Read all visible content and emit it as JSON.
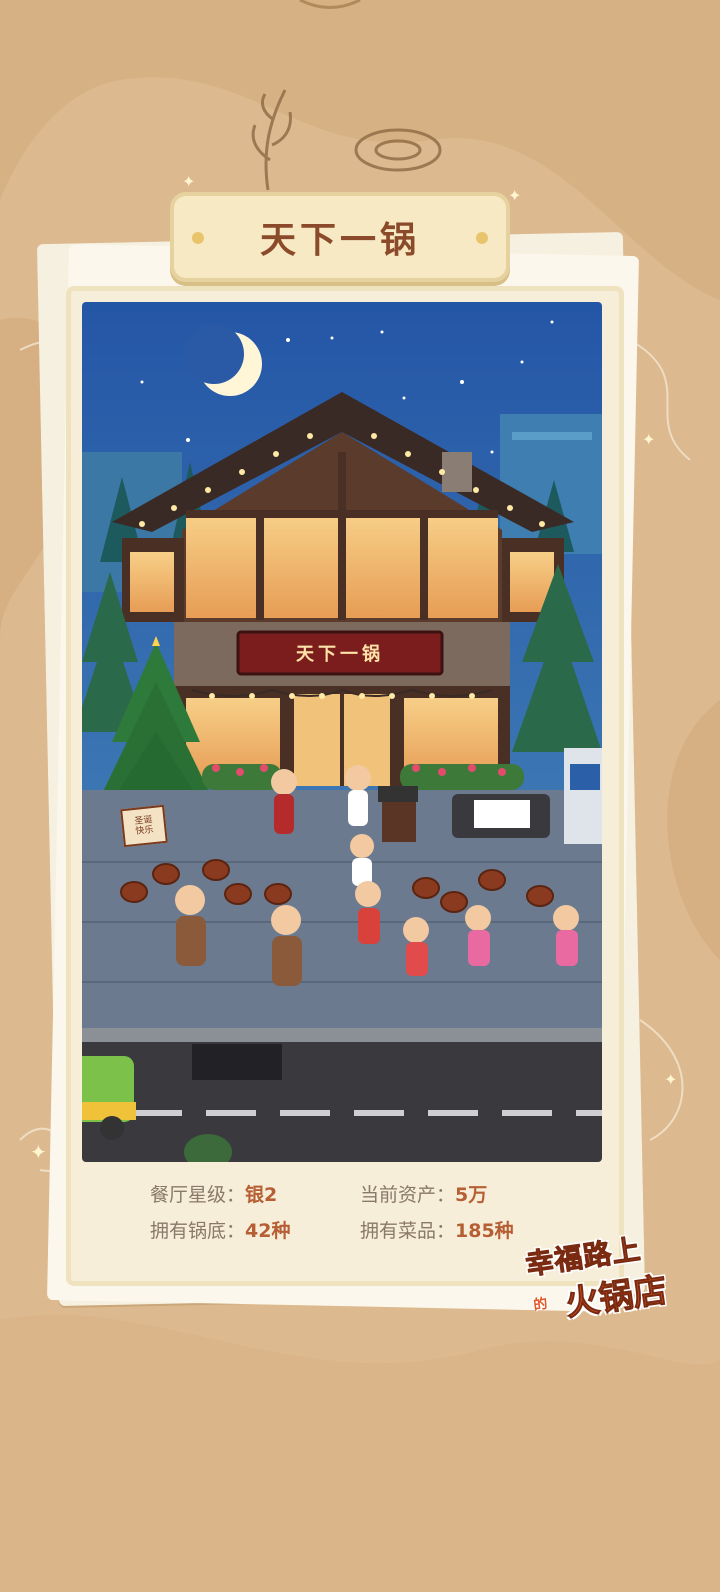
{
  "restaurant": {
    "name": "天下一锅",
    "sign_text": "天下一锅",
    "tree_sign": "圣诞快乐"
  },
  "stats": {
    "star_label": "餐厅星级：",
    "star_value": "银2",
    "assets_label": "当前资产：",
    "assets_value": "5万",
    "bases_label": "拥有锅底：",
    "bases_value": "42种",
    "dishes_label": "拥有菜品：",
    "dishes_value": "185种"
  },
  "logo": {
    "line1": "幸福路上",
    "small": "的",
    "line2": "火锅店"
  },
  "colors": {
    "background": "#dcb98e",
    "card": "#f6eed8",
    "title": "#8b4a2a",
    "accent": "#b65f35",
    "sky": "#2f5da3"
  }
}
